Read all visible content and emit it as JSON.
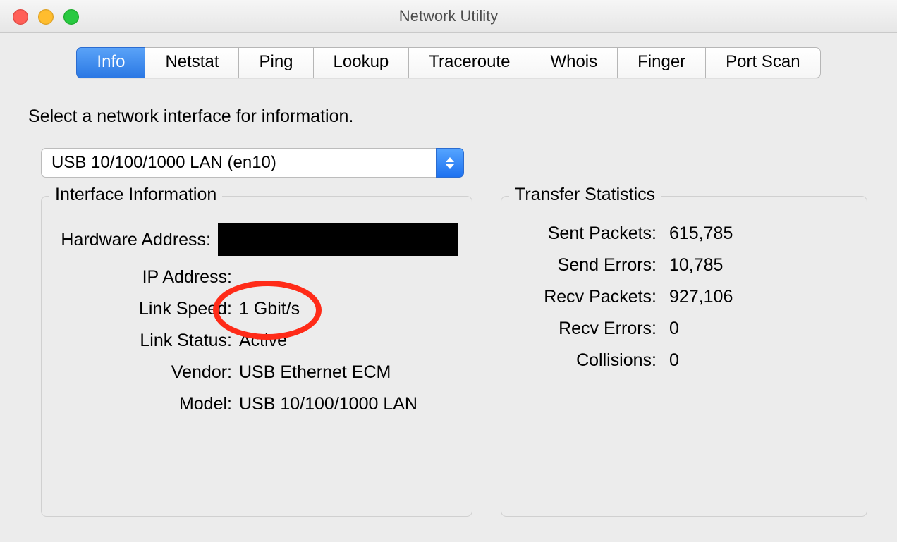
{
  "window": {
    "title": "Network Utility"
  },
  "tabs": [
    "Info",
    "Netstat",
    "Ping",
    "Lookup",
    "Traceroute",
    "Whois",
    "Finger",
    "Port Scan"
  ],
  "active_tab_index": 0,
  "prompt": "Select a network interface for information.",
  "interface_select": {
    "value": "USB 10/100/1000 LAN (en10)"
  },
  "group_left_title": "Interface Information",
  "group_right_title": "Transfer Statistics",
  "interface_info": {
    "hardware_address_label": "Hardware Address:",
    "hardware_address_value": "",
    "ip_address_label": "IP Address:",
    "ip_address_value": "",
    "link_speed_label": "Link Speed:",
    "link_speed_value": "1 Gbit/s",
    "link_status_label": "Link Status:",
    "link_status_value": "Active",
    "vendor_label": "Vendor:",
    "vendor_value": "USB Ethernet ECM",
    "model_label": "Model:",
    "model_value": "USB 10/100/1000 LAN"
  },
  "transfer_stats": {
    "sent_packets_label": "Sent Packets:",
    "sent_packets_value": "615,785",
    "send_errors_label": "Send Errors:",
    "send_errors_value": "10,785",
    "recv_packets_label": "Recv Packets:",
    "recv_packets_value": "927,106",
    "recv_errors_label": "Recv Errors:",
    "recv_errors_value": "0",
    "collisions_label": "Collisions:",
    "collisions_value": "0"
  }
}
